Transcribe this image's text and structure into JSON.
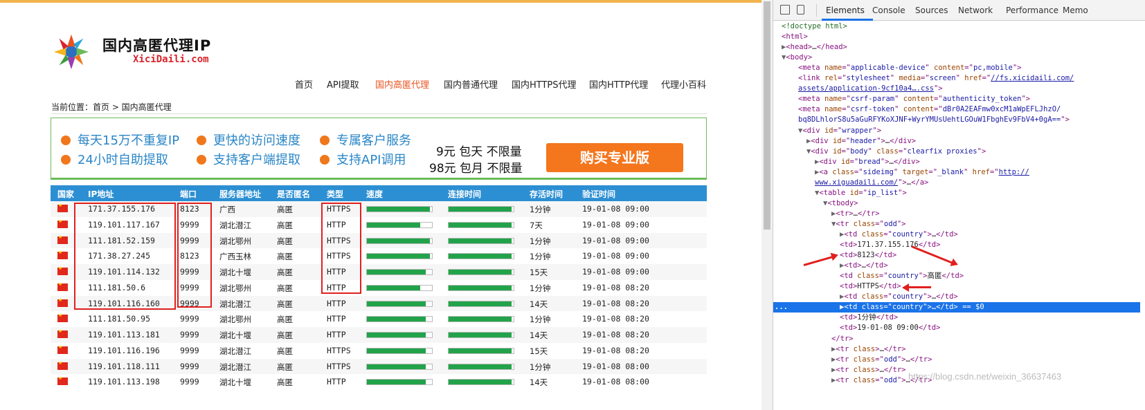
{
  "site": {
    "title": "国内高匿代理IP",
    "subtitle": "XiciDaili.com",
    "nav": [
      "首页",
      "API提取",
      "国内高匿代理",
      "国内普通代理",
      "国内HTTPS代理",
      "国内HTTP代理",
      "代理小百科"
    ],
    "breadcrumb": "当前位置：首页 > 国内高匿代理",
    "banner": {
      "features": [
        "每天15万不重复IP",
        "更快的访问速度",
        "专属客户服务",
        "24小时自助提取",
        "支持客户端提取",
        "支持API调用"
      ],
      "price1": "9元 包天 不限量",
      "price2": "98元 包月 不限量",
      "buy_label": "购买专业版"
    },
    "table": {
      "headers": [
        "国家",
        "IP地址",
        "端口",
        "服务器地址",
        "是否匿名",
        "类型",
        "速度",
        "连接时间",
        "存活时间",
        "验证时间"
      ],
      "rows": [
        {
          "ip": "171.37.155.176",
          "port": "8123",
          "addr": "广西",
          "anon": "高匿",
          "type": "HTTPS",
          "speed": 0.97,
          "conn": 0.97,
          "alive": "1分钟",
          "verified": "19-01-08 09:00"
        },
        {
          "ip": "119.101.117.167",
          "port": "9999",
          "addr": "湖北潜江",
          "anon": "高匿",
          "type": "HTTP",
          "speed": 0.82,
          "conn": 0.97,
          "alive": "7天",
          "verified": "19-01-08 09:00"
        },
        {
          "ip": "111.181.52.159",
          "port": "9999",
          "addr": "湖北鄂州",
          "anon": "高匿",
          "type": "HTTPS",
          "speed": 0.97,
          "conn": 0.97,
          "alive": "1分钟",
          "verified": "19-01-08 09:00"
        },
        {
          "ip": "171.38.27.245",
          "port": "8123",
          "addr": "广西玉林",
          "anon": "高匿",
          "type": "HTTPS",
          "speed": 0.97,
          "conn": 0.97,
          "alive": "1分钟",
          "verified": "19-01-08 09:00"
        },
        {
          "ip": "119.101.114.132",
          "port": "9999",
          "addr": "湖北十堰",
          "anon": "高匿",
          "type": "HTTP",
          "speed": 0.9,
          "conn": 0.97,
          "alive": "15天",
          "verified": "19-01-08 09:00"
        },
        {
          "ip": "111.181.50.6",
          "port": "9999",
          "addr": "湖北鄂州",
          "anon": "高匿",
          "type": "HTTP",
          "speed": 0.82,
          "conn": 0.97,
          "alive": "1分钟",
          "verified": "19-01-08 08:20"
        },
        {
          "ip": "119.101.116.160",
          "port": "9999",
          "addr": "湖北潜江",
          "anon": "高匿",
          "type": "HTTP",
          "speed": 0.9,
          "conn": 0.97,
          "alive": "14天",
          "verified": "19-01-08 08:20"
        },
        {
          "ip": "111.181.50.95",
          "port": "9999",
          "addr": "湖北鄂州",
          "anon": "高匿",
          "type": "HTTP",
          "speed": 0.9,
          "conn": 0.97,
          "alive": "1分钟",
          "verified": "19-01-08 08:20"
        },
        {
          "ip": "119.101.113.181",
          "port": "9999",
          "addr": "湖北十堰",
          "anon": "高匿",
          "type": "HTTP",
          "speed": 0.9,
          "conn": 0.97,
          "alive": "14天",
          "verified": "19-01-08 08:20"
        },
        {
          "ip": "119.101.116.196",
          "port": "9999",
          "addr": "湖北潜江",
          "anon": "高匿",
          "type": "HTTPS",
          "speed": 0.9,
          "conn": 0.97,
          "alive": "15天",
          "verified": "19-01-08 08:20"
        },
        {
          "ip": "119.101.118.111",
          "port": "9999",
          "addr": "湖北潜江",
          "anon": "高匿",
          "type": "HTTPS",
          "speed": 0.9,
          "conn": 0.97,
          "alive": "1分钟",
          "verified": "19-01-08 08:00"
        },
        {
          "ip": "119.101.113.198",
          "port": "9999",
          "addr": "湖北十堰",
          "anon": "高匿",
          "type": "HTTP",
          "speed": 0.9,
          "conn": 0.97,
          "alive": "14天",
          "verified": "19-01-08 08:00"
        }
      ]
    },
    "colors": {
      "accent": "#e8531f",
      "header_blue": "#2c8fd3",
      "bar_green": "#22a34a",
      "highlight_red": "#e0201e"
    }
  },
  "devtools": {
    "tabs": [
      "Elements",
      "Console",
      "Sources",
      "Network",
      "Performance",
      "Memo"
    ],
    "active_tab": "Elements",
    "dom_lines": [
      {
        "indent": 0,
        "tri": "",
        "html": "<span class='cm'>&lt;!doctype html&gt;</span>"
      },
      {
        "indent": 0,
        "tri": "",
        "html": "&lt;html&gt;"
      },
      {
        "indent": 0,
        "tri": "▶",
        "html": "&lt;head&gt;<span class='tx'>…</span>&lt;/head&gt;"
      },
      {
        "indent": 0,
        "tri": "▼",
        "html": "&lt;body&gt;"
      },
      {
        "indent": 2,
        "tri": "",
        "html": "&lt;meta <span class='an'>name</span>=\"<span class='av'>applicable-device</span>\" <span class='an'>content</span>=\"<span class='av'>pc,mobile</span>\"&gt;"
      },
      {
        "indent": 2,
        "tri": "",
        "html": "&lt;link <span class='an'>rel</span>=\"<span class='av'>stylesheet</span>\" <span class='an'>media</span>=\"<span class='av'>screen</span>\" <span class='an'>href</span>=\"<span class='ln'>//fs.xicidaili.com/</span>"
      },
      {
        "indent": 2,
        "tri": "",
        "html": "<span class='ln'>assets/application-9cf10a4….css</span>\"&gt;"
      },
      {
        "indent": 2,
        "tri": "",
        "html": "&lt;meta <span class='an'>name</span>=\"<span class='av'>csrf-param</span>\" <span class='an'>content</span>=\"<span class='av'>authenticity_token</span>\"&gt;"
      },
      {
        "indent": 2,
        "tri": "",
        "html": "&lt;meta <span class='an'>name</span>=\"<span class='av'>csrf-token</span>\" <span class='an'>content</span>=\"<span class='av'>dBr0A2EAFmw0xcM1aWpEFLJhzO/</span>"
      },
      {
        "indent": 2,
        "tri": "",
        "html": "<span class='av'>bq8DLhlorS8u5aGuRFYKoXJNF+WyrYMUsUehtLGOuW1FbghEv9FbV4+0gA==</span>\"&gt;"
      },
      {
        "indent": 2,
        "tri": "▼",
        "html": "&lt;div <span class='an'>id</span>=\"<span class='av'>wrapper</span>\"&gt;"
      },
      {
        "indent": 3,
        "tri": "▶",
        "html": "&lt;div <span class='an'>id</span>=\"<span class='av'>header</span>\"&gt;<span class='tx'>…</span>&lt;/div&gt;"
      },
      {
        "indent": 3,
        "tri": "▼",
        "html": "&lt;div <span class='an'>id</span>=\"<span class='av'>body</span>\" <span class='an'>class</span>=\"<span class='av'>clearfix proxies</span>\"&gt;"
      },
      {
        "indent": 4,
        "tri": "▶",
        "html": "&lt;div <span class='an'>id</span>=\"<span class='av'>bread</span>\"&gt;<span class='tx'>…</span>&lt;/div&gt;"
      },
      {
        "indent": 4,
        "tri": "▶",
        "html": "&lt;a <span class='an'>class</span>=\"<span class='av'>sideimg</span>\" <span class='an'>target</span>=\"<span class='av'>_blank</span>\" <span class='an'>href</span>=\"<span class='ln'>http://</span>"
      },
      {
        "indent": 4,
        "tri": "",
        "html": "<span class='ln'>www.xiguadaili.com/</span>\"&gt;<span class='tx'>…</span>&lt;/a&gt;"
      },
      {
        "indent": 4,
        "tri": "▼",
        "html": "&lt;table <span class='an'>id</span>=\"<span class='av'>ip_list</span>\"&gt;"
      },
      {
        "indent": 5,
        "tri": "▼",
        "html": "&lt;tbody&gt;"
      },
      {
        "indent": 6,
        "tri": "▶",
        "html": "&lt;tr&gt;<span class='tx'>…</span>&lt;/tr&gt;"
      },
      {
        "indent": 6,
        "tri": "▼",
        "html": "&lt;tr <span class='an'>class</span>=\"<span class='av'>odd</span>\"&gt;"
      },
      {
        "indent": 7,
        "tri": "▶",
        "html": "&lt;td <span class='an'>class</span>=\"<span class='av'>country</span>\"&gt;<span class='tx'>…</span>&lt;/td&gt;"
      },
      {
        "indent": 7,
        "tri": "",
        "html": "&lt;td&gt;<span class='tx'>171.37.155.176</span>&lt;/td&gt;"
      },
      {
        "indent": 7,
        "tri": "",
        "html": "&lt;td&gt;<span class='tx'>8123</span>&lt;/td&gt;"
      },
      {
        "indent": 7,
        "tri": "▶",
        "html": "&lt;td&gt;<span class='tx'>…</span>&lt;/td&gt;"
      },
      {
        "indent": 7,
        "tri": "",
        "html": "&lt;td <span class='an'>class</span>=\"<span class='av'>country</span>\"&gt;<span class='tx'>高匿</span>&lt;/td&gt;"
      },
      {
        "indent": 7,
        "tri": "",
        "html": "&lt;td&gt;<span class='tx'>HTTPS</span>&lt;/td&gt;"
      },
      {
        "indent": 7,
        "tri": "▶",
        "html": "&lt;td <span class='an'>class</span>=\"<span class='av'>country</span>\"&gt;<span class='tx'>…</span>&lt;/td&gt;"
      },
      {
        "indent": 7,
        "tri": "▶",
        "html": "&lt;td <span class='an'>class</span>=\"<span class='av'>country</span>\"&gt;<span class='tx'>…</span>&lt;/td&gt; <span class='tx'>== $0</span>",
        "selected": true
      },
      {
        "indent": 7,
        "tri": "",
        "html": "&lt;td&gt;<span class='tx'>1分钟</span>&lt;/td&gt;"
      },
      {
        "indent": 7,
        "tri": "",
        "html": "&lt;td&gt;<span class='tx'>19-01-08 09:00</span>&lt;/td&gt;"
      },
      {
        "indent": 6,
        "tri": "",
        "html": "&lt;/tr&gt;"
      },
      {
        "indent": 6,
        "tri": "▶",
        "html": "&lt;tr <span class='an'>class</span>&gt;<span class='tx'>…</span>&lt;/tr&gt;"
      },
      {
        "indent": 6,
        "tri": "▶",
        "html": "&lt;tr <span class='an'>class</span>=\"<span class='av'>odd</span>\"&gt;<span class='tx'>…</span>&lt;/tr&gt;"
      },
      {
        "indent": 6,
        "tri": "▶",
        "html": "&lt;tr <span class='an'>class</span>&gt;<span class='tx'>…</span>&lt;/tr&gt;"
      },
      {
        "indent": 6,
        "tri": "▶",
        "html": "&lt;tr <span class='an'>class</span>=\"<span class='av'>odd</span>\"&gt;<span class='tx'>…</span>&lt;/tr&gt;"
      }
    ],
    "selected_marker": "..."
  },
  "watermark": "https://blog.csdn.net/weixin_36637463"
}
